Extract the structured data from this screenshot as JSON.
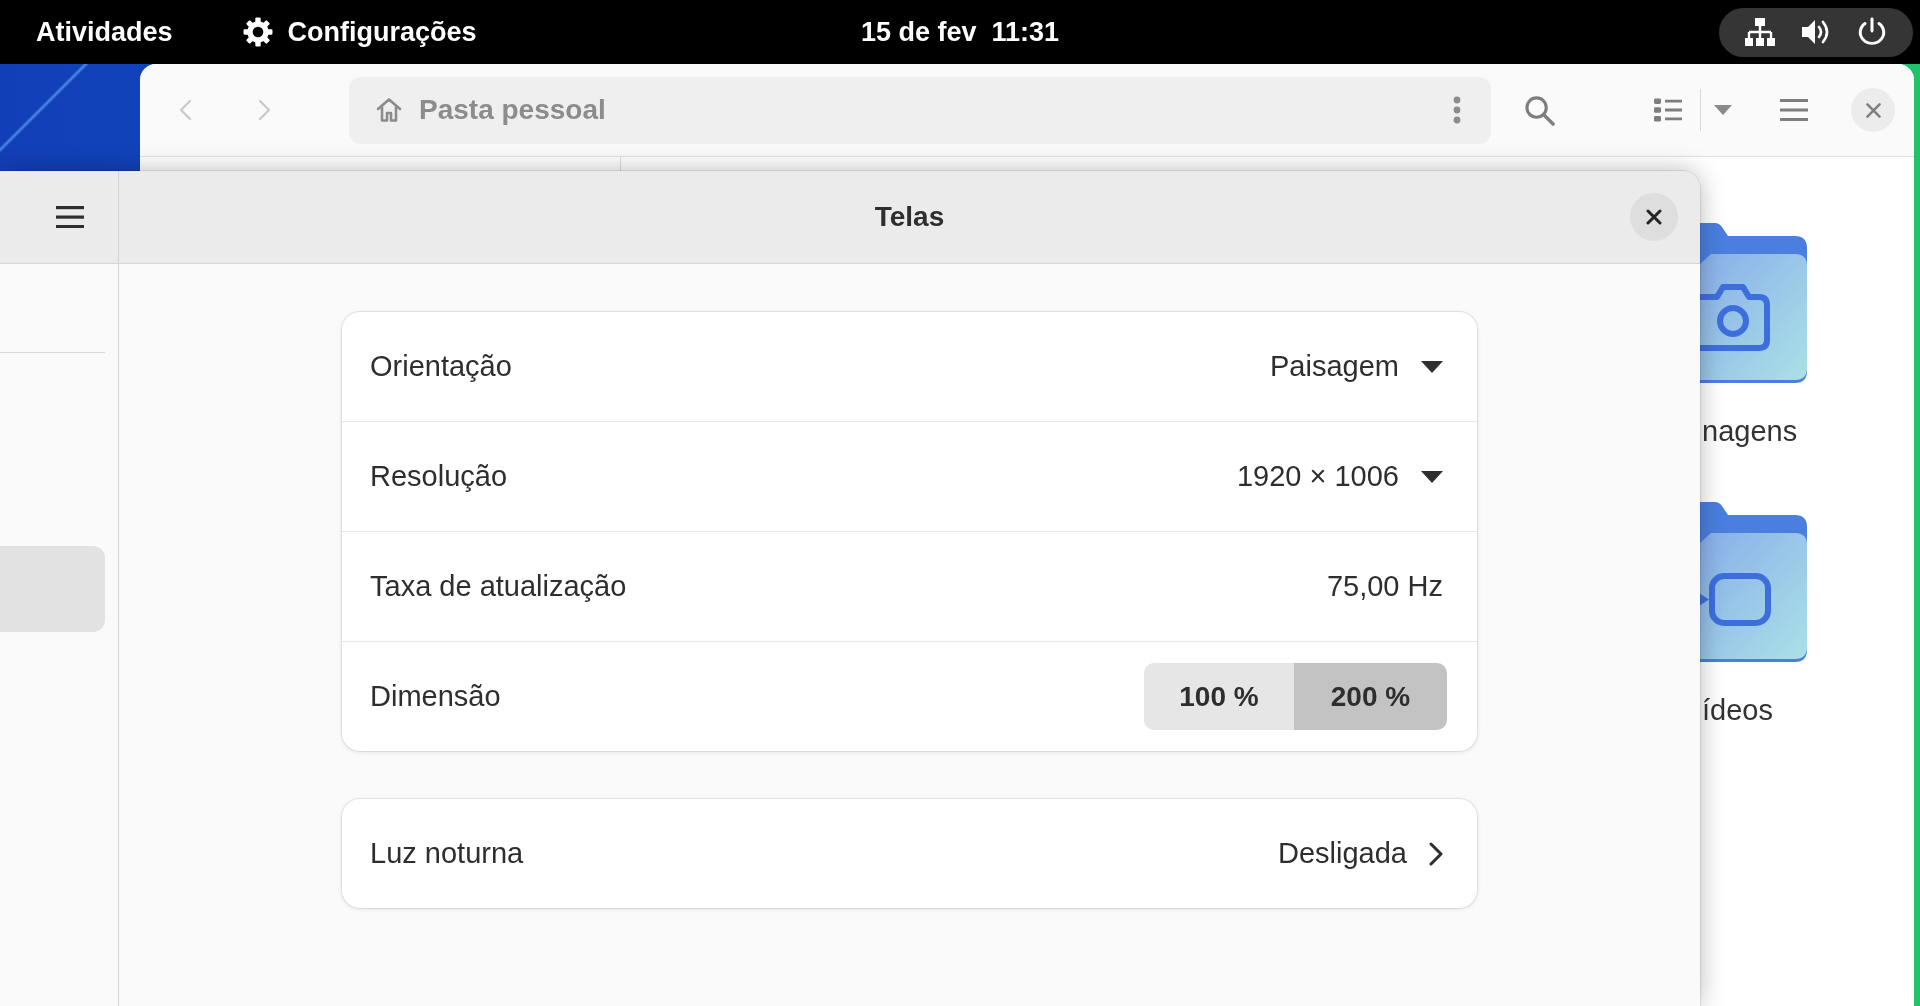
{
  "top_bar": {
    "activities": "Atividades",
    "app_menu": "Configurações",
    "clock": "15 de fev  11:31"
  },
  "files_window": {
    "nav_buttons": [
      {
        "kind": "back",
        "disabled": true
      },
      {
        "kind": "forward",
        "disabled": true
      }
    ],
    "location": "Pasta pessoal",
    "folders": [
      {
        "kind": "pictures",
        "label": "nagens"
      },
      {
        "kind": "videos",
        "label": "ídeos"
      }
    ]
  },
  "settings_window": {
    "title": "Telas",
    "sidebar": {
      "rows": [
        {
          "selected": true
        }
      ]
    },
    "cards": [
      {
        "rows": [
          {
            "kind": "dropdown",
            "label": "Orientação",
            "value": "Paisagem"
          },
          {
            "kind": "dropdown",
            "label": "Resolução",
            "value": "1920 × 1006"
          },
          {
            "kind": "info",
            "label": "Taxa de atualização",
            "value": "75,00 Hz"
          },
          {
            "kind": "segmented",
            "label": "Dimensão",
            "options": [
              {
                "label": "100 %",
                "selected": false
              },
              {
                "label": "200 %",
                "selected": true
              }
            ]
          }
        ]
      },
      {
        "rows": [
          {
            "kind": "link",
            "label": "Luz noturna",
            "value": "Desligada"
          }
        ]
      }
    ]
  }
}
